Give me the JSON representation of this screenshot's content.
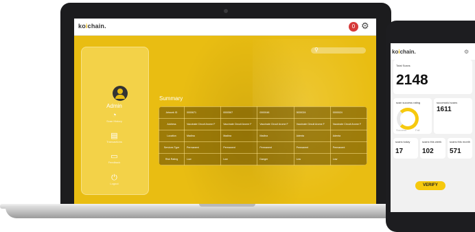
{
  "laptop": {
    "app_logo": {
      "prefix": "ko",
      "highlight": "i",
      "suffix": "chain."
    },
    "notification_count": "0",
    "sidebar": {
      "user_name": "Admin",
      "items": [
        {
          "icon": "speedometer-icon",
          "label": "Scan History"
        },
        {
          "icon": "document-icon",
          "label": "Transactions"
        },
        {
          "icon": "chat-icon",
          "label": "Feedback"
        },
        {
          "icon": "power-icon",
          "label": "Logout"
        }
      ]
    },
    "summary": {
      "title": "Summary",
      "rows": [
        {
          "label": "Artwork ID",
          "cells": [
            "0000671",
            "0000567",
            "0000048",
            "0000024",
            "0000024"
          ]
        },
        {
          "label": "Address",
          "cells": [
            "Vaccinate Circuit Arome F",
            "Vaccinate Circuit Arome F",
            "Vaccinate Circuit Arome F",
            "Vaccinate Circuit Arome F",
            "Vaccinate Circuit Arome F"
          ]
        },
        {
          "label": "Location",
          "cells": [
            "Madina",
            "Madina",
            "Madina",
            "Adenta",
            "Adenta"
          ]
        },
        {
          "label": "Services Type",
          "cells": [
            "Permanent",
            "Permanent",
            "Permanent",
            "Permanent",
            "Permanent"
          ]
        },
        {
          "label": "Risk Rating",
          "cells": [
            "Low",
            "Low",
            "Danger",
            "Low",
            "Low"
          ]
        }
      ]
    }
  },
  "phone": {
    "app_logo": {
      "prefix": "ko",
      "highlight": "i",
      "suffix": "chain."
    },
    "total_scans": {
      "label": "Total Scans",
      "value": "2148"
    },
    "success_rate": {
      "label": "scan success rating",
      "legend_a": "Success",
      "legend_b": "Fail"
    },
    "successful_scans": {
      "label": "successful scans",
      "value": "1611"
    },
    "stats": [
      {
        "label": "scans today",
        "value": "17"
      },
      {
        "label": "scans this week",
        "value": "102"
      },
      {
        "label": "scans this month",
        "value": "571"
      }
    ],
    "verify_button": "VERIFY"
  },
  "colors": {
    "accent": "#e9bd12",
    "button": "#f6c90e",
    "frame": "#1c1c1e"
  }
}
